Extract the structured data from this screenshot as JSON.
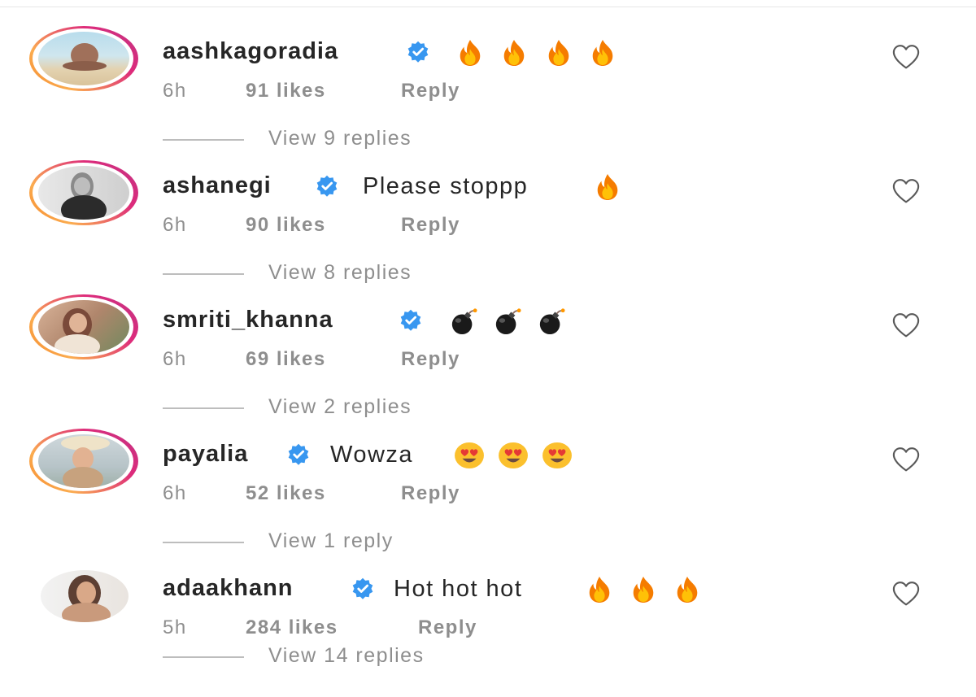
{
  "comments": [
    {
      "username": "aashkagoradia",
      "verified": true,
      "text": "",
      "emojis": [
        "fire-emoji",
        "fire-emoji",
        "fire-emoji",
        "fire-emoji"
      ],
      "time": "6h",
      "likes": "91 likes",
      "reply_label": "Reply",
      "view_replies": "View 9 replies",
      "story_ring": true
    },
    {
      "username": "ashanegi",
      "verified": true,
      "text": "Please stoppp",
      "emojis": [
        "fire-emoji"
      ],
      "time": "6h",
      "likes": "90 likes",
      "reply_label": "Reply",
      "view_replies": "View 8 replies",
      "story_ring": true
    },
    {
      "username": "smriti_khanna",
      "verified": true,
      "text": "",
      "emojis": [
        "bomb-emoji",
        "bomb-emoji",
        "bomb-emoji"
      ],
      "time": "6h",
      "likes": "69 likes",
      "reply_label": "Reply",
      "view_replies": "View 2 replies",
      "story_ring": true
    },
    {
      "username": "payalia",
      "verified": true,
      "text": "Wowza",
      "emojis": [
        "heart-eyes-emoji",
        "heart-eyes-emoji",
        "heart-eyes-emoji"
      ],
      "time": "6h",
      "likes": "52 likes",
      "reply_label": "Reply",
      "view_replies": "View 1 reply",
      "story_ring": true
    },
    {
      "username": "adaakhann",
      "verified": true,
      "text": "Hot hot hot",
      "emojis": [
        "fire-emoji",
        "fire-emoji",
        "fire-emoji"
      ],
      "time": "5h",
      "likes": "284 likes",
      "reply_label": "Reply",
      "view_replies": "View 14 replies",
      "story_ring": false
    }
  ],
  "colors": {
    "text_primary": "#262626",
    "text_secondary": "#8e8e8e",
    "verified_blue": "#3897f0",
    "ring_gradient": [
      "#f58529",
      "#dd2a7b",
      "#c13584"
    ]
  }
}
